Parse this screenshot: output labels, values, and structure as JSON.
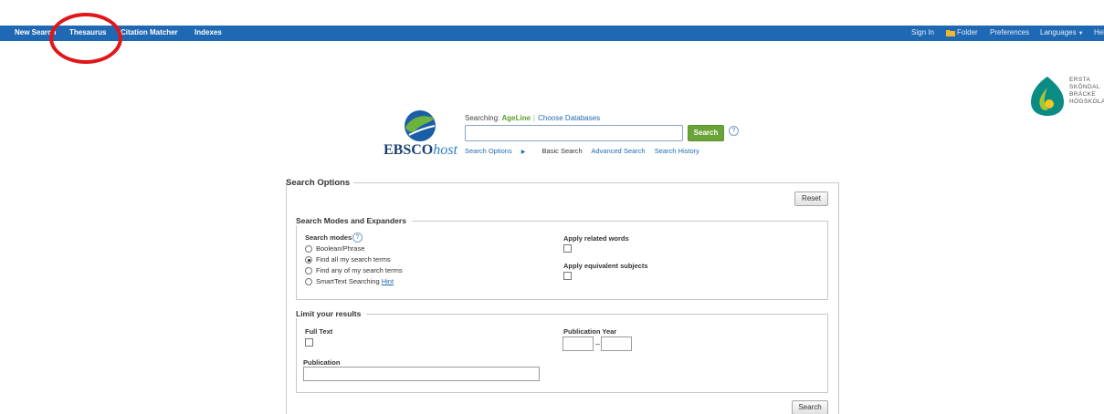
{
  "topnav": {
    "left": [
      "New Search",
      "Thesaurus",
      "Citation Matcher",
      "Indexes"
    ],
    "right": {
      "sign_in": "Sign In",
      "folder": "Folder",
      "preferences": "Preferences",
      "languages": "Languages",
      "help": "Help"
    }
  },
  "institution": {
    "lines": "ERSTA\nSKÖNDAL\nBRÄCKE\nHÖGSKOLA"
  },
  "brand": {
    "name_bold": "EBSCO",
    "name_italic": "host"
  },
  "searching": {
    "label": "Searching:",
    "database": "AgeLine",
    "choose": "Choose Databases"
  },
  "search": {
    "value": "",
    "button": "Search",
    "help": "?"
  },
  "subnav": {
    "options": "Search Options",
    "basic": "Basic Search",
    "advanced": "Advanced Search",
    "history": "Search History"
  },
  "options": {
    "title": "Search Options",
    "reset": "Reset",
    "modes_section": {
      "title": "Search Modes and Expanders",
      "modes_label": "Search modes",
      "modes": [
        {
          "label": "Boolean/Phrase",
          "selected": false
        },
        {
          "label": "Find all my search terms",
          "selected": true
        },
        {
          "label": "Find any of my search terms",
          "selected": false
        },
        {
          "label": "SmartText Searching",
          "selected": false
        }
      ],
      "hint": "Hint",
      "related_words": "Apply related words",
      "equivalent_subjects": "Apply equivalent subjects"
    },
    "limits_section": {
      "title": "Limit your results",
      "full_text": "Full Text",
      "publication": "Publication",
      "publication_value": "",
      "pub_year": "Publication Year",
      "year_from": "",
      "year_to": "",
      "dash": "–"
    },
    "search_button": "Search"
  },
  "colors": {
    "topbar": "#1f68b3",
    "search_button": "#6aa436",
    "highlight": "#e0161b"
  }
}
